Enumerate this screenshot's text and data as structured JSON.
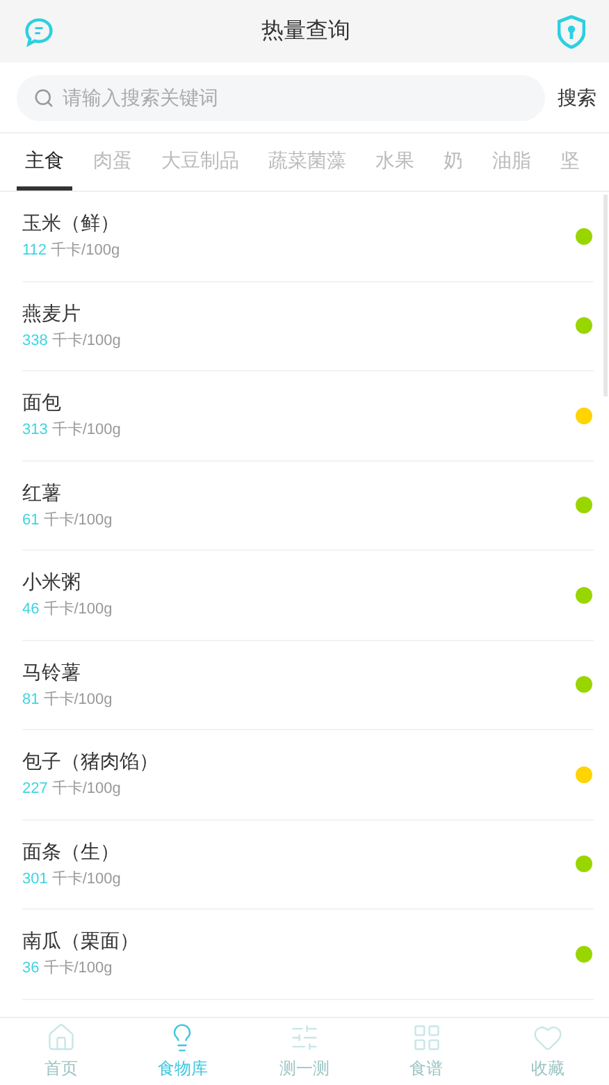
{
  "header": {
    "title": "热量查询"
  },
  "search": {
    "placeholder": "请输入搜索关键词",
    "button": "搜索"
  },
  "tabs": [
    {
      "label": "主食",
      "selected": true
    },
    {
      "label": "肉蛋",
      "selected": false
    },
    {
      "label": "大豆制品",
      "selected": false
    },
    {
      "label": "蔬菜菌藻",
      "selected": false
    },
    {
      "label": "水果",
      "selected": false
    },
    {
      "label": "奶",
      "selected": false
    },
    {
      "label": "油脂",
      "selected": false
    },
    {
      "label": "坚",
      "selected": false
    }
  ],
  "foods": [
    {
      "name": "玉米（鲜）",
      "kcal": "112",
      "unit": "千卡/100g",
      "color": "#99d600"
    },
    {
      "name": "燕麦片",
      "kcal": "338",
      "unit": "千卡/100g",
      "color": "#99d600"
    },
    {
      "name": "面包",
      "kcal": "313",
      "unit": "千卡/100g",
      "color": "#ffd400"
    },
    {
      "name": "红薯",
      "kcal": "61",
      "unit": "千卡/100g",
      "color": "#99d600"
    },
    {
      "name": "小米粥",
      "kcal": "46",
      "unit": "千卡/100g",
      "color": "#99d600"
    },
    {
      "name": "马铃薯",
      "kcal": "81",
      "unit": "千卡/100g",
      "color": "#99d600"
    },
    {
      "name": "包子（猪肉馅）",
      "kcal": "227",
      "unit": "千卡/100g",
      "color": "#ffd400"
    },
    {
      "name": "面条（生）",
      "kcal": "301",
      "unit": "千卡/100g",
      "color": "#99d600"
    },
    {
      "name": "南瓜（栗面）",
      "kcal": "36",
      "unit": "千卡/100g",
      "color": "#99d600"
    }
  ],
  "nav": [
    {
      "label": "首页",
      "kind": "home",
      "selected": false
    },
    {
      "label": "食物库",
      "kind": "bulb",
      "selected": true
    },
    {
      "label": "测一测",
      "kind": "sliders",
      "selected": false
    },
    {
      "label": "食谱",
      "kind": "grid",
      "selected": false
    },
    {
      "label": "收藏",
      "kind": "heart",
      "selected": false
    }
  ]
}
